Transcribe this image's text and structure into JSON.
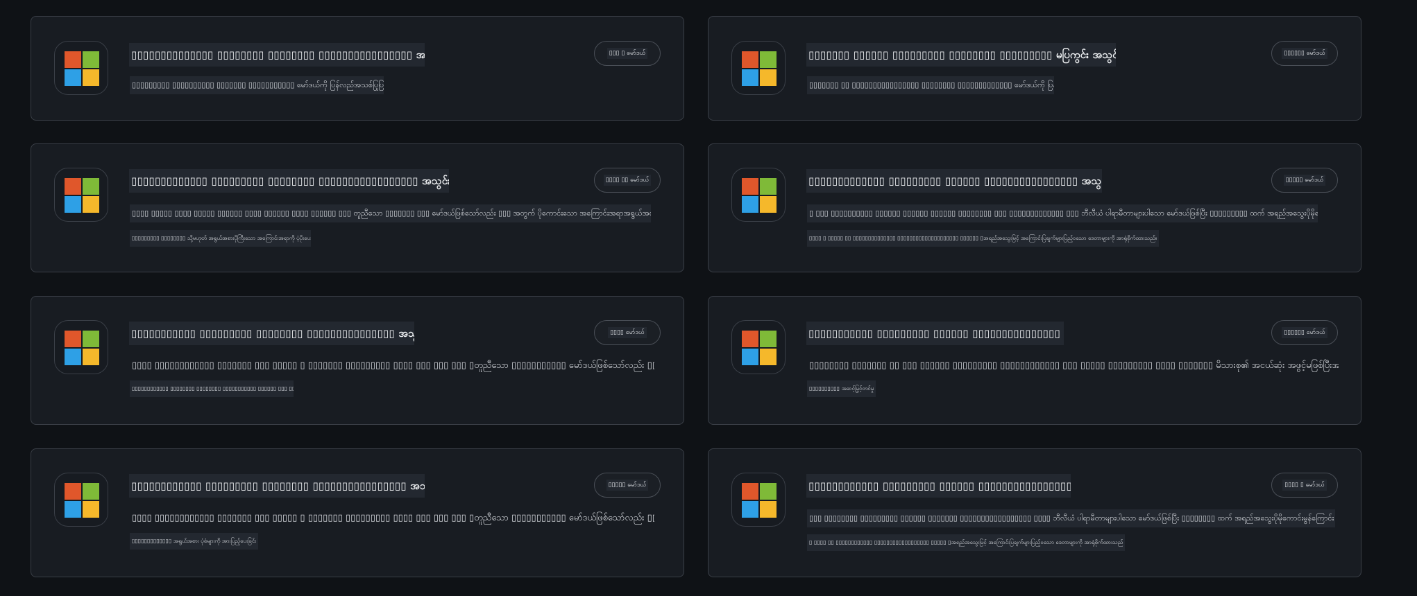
{
  "cards": [
    {
      "title": "▯▯▯▯▯▯▯▯▯▯▯▯▯▯ ▯▯▯▯▯▯▯▯ ▯▯▯▯▯▯▯▯ ▯▯▯▯▯▯▯▯▯▯▯▯▯▯▯▯ အသွင်း ▯▯▯▯▯▯▯▯",
      "desc1": "▯▯▯▯▯▯▯▯▯ ▯▯▯▯▯▯▯▯▯▯ ▯▯▯▯▯▯▯ ▯▯▯▯▯▯▯▯▯▯▯ မော်ဒယ်ကို ပြန်လည်အသစ်ပြုပြင်ခြင်း",
      "desc2": "",
      "button": "▯▯▯ ▯ မော်ဒယ်"
    },
    {
      "title": "▯▯▯▯▯▯▯ ▯▯▯▯▯▯ ▯▯▯▯▯▯▯▯▯ ▯▯▯▯▯▯▯▯ ▯▯▯▯▯▯▯▯▯ မပြကွင်း အသွင်း ▯▯▯▯▯▯▯▯",
      "desc1": "▯▯▯▯▯▯▯ ▯▯ ▯▯▯▯▯▯▯▯▯▯▯▯▯▯▯▯ ▯▯▯▯▯▯▯▯ ▯▯▯▯▯▯▯▯▯▯▯▯▯ မော်ဒယ်ကို ပြန်လည်အသစ်ပြုပြင်ခြင်း",
      "desc2": "",
      "button": "▯▯▯▯▯▯ မော်ဒယ်"
    },
    {
      "title": "▯▯▯▯▯▯▯▯▯▯▯▯▯ ▯▯▯▯▯▯▯▯▯ ▯▯▯▯▯▯▯▯ ▯▯▯▯▯▯▯▯▯▯▯▯▯▯▯▯▯ အသွင်း ▯▯▯▯▯▯▯▯",
      "desc1": "▯▯▯▯ ▯▯▯▯▯ ▯▯▯▯ ▯▯▯▯▯ ▯▯▯▯▯▯ ▯▯▯▯ ▯▯▯▯▯▯ ▯▯▯▯ ▯▯▯▯▯▯ ▯▯▯ တူညီသော ▯▯▯▯▯▯▯ ▯▯▯ မော်ဒယ်ဖြစ်သော်လည်း ▯▯▯ အတွက် ပိုကောင်းသော အကြောင်းအရာအရွယ်အစားပါရှိသည်။",
      "desc2": "▯▯▯▯▯▯▯▯▯ ▯▯▯▯▯▯▯▯ သို့မဟုတ် အရွယ်အစားပိုကြီးသော အကြောင်းအရာကို ပံ့ပိုးပေးသည်",
      "button": "▯▯▯▯ ▯▯ မော်ဒယ်"
    },
    {
      "title": "▯▯▯▯▯▯▯▯▯▯▯▯▯ ▯▯▯▯▯▯▯▯▯ ▯▯▯▯▯▯ ▯▯▯▯▯▯▯▯▯▯▯▯▯▯▯▯ အသွင်း ▯▯▯▯▯",
      "desc1": "▯ ▯▯▯ ▯▯▯▯▯▯▯▯▯▯ ▯▯▯▯▯▯ ▯▯▯▯▯▯ ▯▯▯▯▯▯ ▯▯▯▯▯▯▯▯ ▯▯▯ ▯▯▯▯▯▯▯▯▯▯▯▯▯ ▯▯▯ ဘီလီယံ ပါရာမီတာများပါသော မော်ဒယ်ဖြစ်ပြီး ▯▯▯▯▯▯▯▯▯ ထက် အရည်အသွေးပိုမိုကောင်းမွန်ကြောင်း သက်သေပြသည်",
      "desc2": "▯▯▯▯ ▯ ▯▯▯▯▯ ▯▯ ▯▯▯▯▯▯▯▯▯▯▯▯▯▯ ▯▯▯▯▯▯▯▯▯▯▯▯▯▯▯▯▯▯▯▯ ▯▯▯▯▯▯ ▯အရည်အသွေးမြင့် အကြောင်းပြချက်များပြည့်ဝသော ဒေတာများကို အာရုံစိုက်ထားသည်။",
      "button": "▯▯▯▯▯ မော်ဒယ်"
    },
    {
      "title": "▯▯▯▯▯▯▯▯▯▯▯ ▯▯▯▯▯▯▯▯▯ ▯▯▯▯▯▯▯▯ ▯▯▯▯▯▯▯▯▯▯▯▯▯▯▯ အသွင်း ▯▯▯▯▯▯▯▯",
      "desc1": "▯▯▯▯ ▯▯▯▯▯▯▯▯▯▯▯▯ ▯▯▯▯▯▯▯ ▯▯▯ ▯▯▯▯▯ ▯ ▯▯▯▯▯▯▯ ▯▯▯▯▯▯▯▯▯ ▯▯▯▯ ▯▯▯ ▯▯▯ ▯▯▯ ▯တူညီသော ▯▯▯▯▯▯▯▯▯▯▯ မော်ဒယ်ဖြစ်သော်လည်း ▯▯▯ သို့မဟုတ်▯",
      "desc2": "▯▯▯▯▯▯▯▯▯▯▯▯ ▯▯▯▯▯▯▯▯ ▯▯▯▯▯▯▯▯ ▯▯▯▯▯▯▯▯▯▯▯ ▯▯▯▯▯▯ ▯▯▯ ▯▯▯",
      "button": "▯▯▯▯ မော်ဒယ်"
    },
    {
      "title": "▯▯▯▯▯▯▯▯▯▯▯ ▯▯▯▯▯▯▯▯▯ ▯▯▯▯▯▯ ▯▯▯▯▯▯▯▯▯▯▯▯▯▯▯ အသွင်း ▯▯▯▯▯",
      "desc1": "▯▯▯▯▯▯▯▯ ▯▯▯▯▯▯▯ ▯▯ ▯▯▯ ▯▯▯▯▯▯ ▯▯▯▯▯▯▯▯▯ ▯▯▯▯▯▯▯▯▯▯▯▯ ▯▯▯ ▯▯▯▯▯ ▯▯▯▯▯▯▯▯▯ ▯▯▯▯ ▯▯▯▯▯▯▯ မိသားစု၏ အငယ်ဆုံး အဖွင့်မဖြစ်ပြီးအရည်အသွေးနှင့်▯",
      "desc2": "▯▯▯▯▯▯▯▯▯▯ အဆင့်မြှင့်တင်မှု",
      "button": "▯▯▯▯▯▯ မော်ဒယ်"
    },
    {
      "title": "▯▯▯▯▯▯▯▯▯▯▯▯ ▯▯▯▯▯▯▯▯▯ ▯▯▯▯▯▯▯▯ ▯▯▯▯▯▯▯▯▯▯▯▯▯▯▯▯ အသွင်း ▯▯▯▯▯▯▯▯",
      "desc1": "▯▯▯▯ ▯▯▯▯▯▯▯▯▯▯▯▯ ▯▯▯▯▯▯▯ ▯▯▯ ▯▯▯▯▯ ▯ ▯▯▯▯▯▯▯ ▯▯▯▯▯▯▯▯▯ ▯▯▯▯ ▯▯▯ ▯▯▯ ▯▯▯ ▯တူညီသော ▯▯▯▯▯▯▯▯▯▯▯ မော်ဒယ်ဖြစ်သော်လည်း ▯▯▯ သို့မဟုတ်▯",
      "desc2": "▯▯▯▯▯▯▯▯▯▯▯▯▯ အရွယ်အစား ပုံစံများကို အားပြည့်ပေးခြင်း",
      "button": "▯▯▯▯▯ မော်ဒယ်"
    },
    {
      "title": "▯▯▯▯▯▯▯▯▯▯▯▯ ▯▯▯▯▯▯▯▯▯ ▯▯▯▯▯▯ ▯▯▯▯▯▯▯▯▯▯▯▯▯▯▯▯ အသွင်း ▯▯▯▯▯",
      "desc1": "▯▯▯ ▯▯▯▯▯▯▯▯ ▯▯▯▯▯▯▯▯▯ ▯▯▯▯▯▯ ▯▯▯▯▯▯▯ ▯▯▯▯▯▯▯▯▯▯▯▯▯▯▯▯▯ ▯▯▯▯ ဘီလီယံ ပါရာမီတာများပါသော မော်ဒယ်ဖြစ်ပြီး ▯▯▯▯▯▯▯▯ ထက် အရည်အသွေးပိုမိုကောင်းမွန်ကြောင်း သက်သေပြသည်",
      "desc2": "▯ ▯▯▯▯ ▯▯ ▯▯▯▯▯▯▯▯▯▯▯▯ ▯▯▯▯▯▯▯▯▯▯▯▯▯▯▯▯▯▯ ▯▯▯▯▯ ▯အရည်အသွေးမြင့် အကြောင်းပြချက်များပြည့်ဝသော ဒေတာများကို အာရုံစိုက်ထားသည်",
      "button": "▯▯▯▯ ▯ မော်ဒယ်"
    }
  ]
}
